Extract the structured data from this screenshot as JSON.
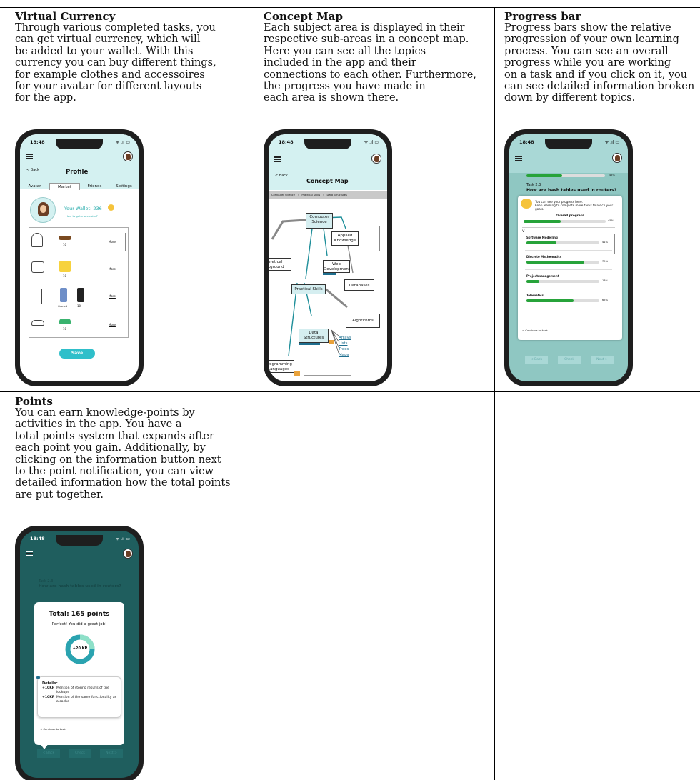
{
  "cells": [
    {
      "title": "Virtual Currency",
      "lines": [
        "Through various completed tasks, you",
        "can get virtual currency, which will",
        "be added to your wallet. With this",
        "currency you can buy different things,",
        "for example clothes and accessoires",
        "for your avatar for different layouts",
        "for the app."
      ]
    },
    {
      "title": "Concept Map",
      "lines": [
        "Each subject area is displayed in their",
        "respective sub-areas in a concept map.",
        "Here you can see all the topics",
        "included in the app and their",
        "connections to each other. Furthermore,",
        "the progress you have made in",
        "each area is shown there."
      ]
    },
    {
      "title": "Progress bar",
      "lines": [
        "Progress bars show the relative",
        "progression of your own learning",
        "process. You can see an overall",
        "progress while you are working",
        "on a task and if you click on it, you",
        "can see detailed information broken",
        "down by different topics."
      ]
    },
    {
      "title": "Points",
      "lines": [
        "You can earn knowledge-points by",
        "activities in the app. You have a",
        "total points system that expands after",
        "each point you gain. Additionally, by",
        "clicking on the information button next",
        "to the point notification, you can view",
        "detailed information how the total points",
        "are put together."
      ]
    }
  ],
  "status": {
    "time": "18:48",
    "icons": "ᯤ .ıl ▭"
  },
  "currency_phone": {
    "back": "< Back",
    "title": "Profile",
    "tabs": [
      "Avatar",
      "Market",
      "Friends",
      "Settings"
    ],
    "wallet": "Your Wallet: 236",
    "more_coins": "How to get more coins?",
    "items": [
      {
        "price1": "10",
        "price2": "",
        "more": "More"
      },
      {
        "price1": "10",
        "price2": "",
        "more": "More"
      },
      {
        "price1": "Owned",
        "price2": "10",
        "more": "More"
      },
      {
        "price1": "10",
        "price2": "",
        "more": "More"
      }
    ],
    "save": "Save"
  },
  "concept_phone": {
    "back": "< Back",
    "title": "Concept Map",
    "crumbs": [
      "Computer Science",
      "Practical Skills",
      "Data Structures"
    ],
    "nodes": {
      "cs": "Computer Science",
      "applied": "Applied Knowledge",
      "theory": "oretical kground",
      "web": "Web Development",
      "db": "Databases",
      "practical": "Practical Skills",
      "algo": "Algorithms",
      "ds": "Data Structures",
      "prog": "rogramming Languages"
    },
    "leaves": [
      "Arrays",
      "Lists",
      "Trees",
      "Maps"
    ]
  },
  "progress_phone": {
    "top_pct": "45%",
    "task": "Task 2.3",
    "question": "How are hash tables used in routers?",
    "intro1": "You can see your progress here.",
    "intro2": "Keep learning to complete more tasks to reach your goals.",
    "overall_label": "Overall progress",
    "overall_pct": "45%",
    "overall_value": 45,
    "topics": [
      {
        "name": "Software Modelling",
        "pct": "41%",
        "value": 41
      },
      {
        "name": "Discrete Mathematics",
        "pct": "79%",
        "value": 79
      },
      {
        "name": "Projectmanagement",
        "pct": "18%",
        "value": 18
      },
      {
        "name": "Telematics",
        "pct": "65%",
        "value": 65
      }
    ],
    "continue": "< Continue to task",
    "buttons": [
      "< Back",
      "Check",
      "Next >"
    ]
  },
  "points_phone": {
    "task": "Task 2.3",
    "question": "How are hash tables used in routers?",
    "total": "Total: 165 points",
    "perfect": "Perfect! You did a great job!",
    "ring_label": "+20 KP",
    "details_title": "Details:",
    "detail1_kp": "+10KP",
    "detail1": "Mention of storing results of trie lookups",
    "detail2_kp": "+10KP",
    "detail2": "Mention of the same functionality as a cache",
    "continue": "< Continue to task",
    "buttons": [
      "< Back",
      "Check",
      "Next >"
    ]
  }
}
